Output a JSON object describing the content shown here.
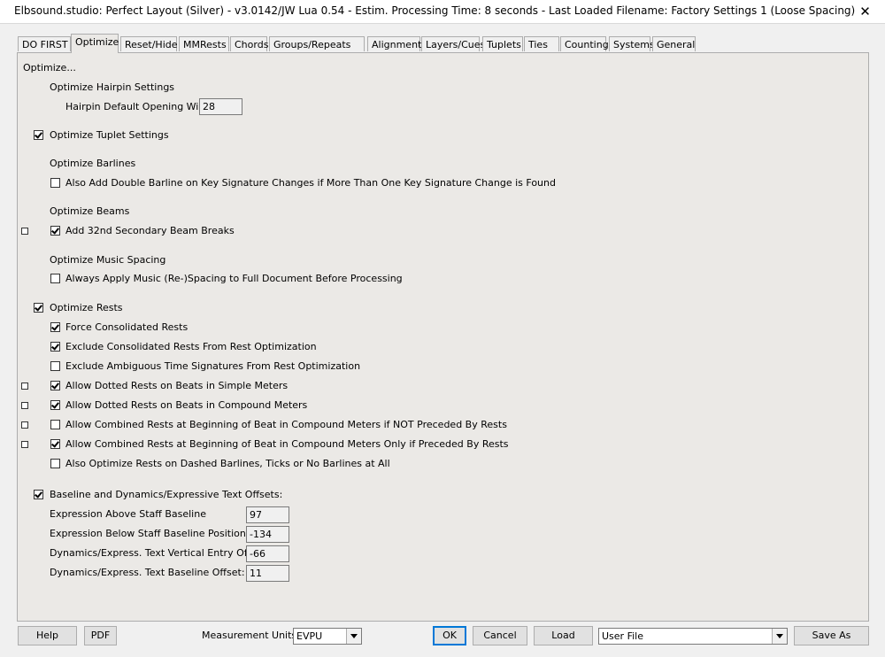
{
  "window": {
    "title": "Elbsound.studio: Perfect Layout (Silver) - v3.0142/JW Lua 0.54 - Estim. Processing Time: 8 seconds - Last Loaded Filename: Factory Settings 1 (Loose Spacing)",
    "close_glyph": "✕"
  },
  "tabs": [
    "DO FIRST",
    "Optimize",
    "Reset/Hide",
    "MMRests",
    "Chords",
    "Groups/Repeats",
    "Alignment",
    "Layers/Cues",
    "Tuplets",
    "Ties",
    "Counting",
    "Systems",
    "General"
  ],
  "optimize": {
    "section_title": "Optimize...",
    "hairpin": {
      "heading": "Optimize Hairpin Settings",
      "width_label": "Hairpin Default Opening Width:",
      "width_value": "28"
    },
    "tuplet": {
      "label": "Optimize Tuplet Settings",
      "checked": true
    },
    "barlines": {
      "heading": "Optimize Barlines",
      "double_label": "Also Add Double Barline on Key Signature Changes if More Than One Key Signature Change is Found",
      "double_checked": false
    },
    "beams": {
      "heading": "Optimize Beams",
      "breaks_label": "Add 32nd Secondary Beam Breaks",
      "breaks_checked": true
    },
    "spacing": {
      "heading": "Optimize Music Spacing",
      "respace_label": "Always Apply Music (Re-)Spacing to Full Document Before Processing",
      "respace_checked": false
    },
    "rests": {
      "label": "Optimize Rests",
      "checked": true,
      "items": [
        {
          "label": "Force Consolidated Rests",
          "checked": true
        },
        {
          "label": "Exclude Consolidated Rests From Rest Optimization",
          "checked": true
        },
        {
          "label": "Exclude Ambiguous Time Signatures From Rest Optimization",
          "checked": false
        },
        {
          "label": "Allow Dotted Rests on Beats in Simple Meters",
          "checked": true
        },
        {
          "label": "Allow Dotted Rests on Beats in Compound Meters",
          "checked": true
        },
        {
          "label": "Allow Combined Rests at Beginning of Beat in Compound Meters if NOT Preceded By Rests",
          "checked": false
        },
        {
          "label": "Allow Combined Rests at Beginning of Beat in Compound Meters Only if Preceded By Rests",
          "checked": true
        },
        {
          "label": "Also Optimize Rests on Dashed Barlines, Ticks or No Barlines at All",
          "checked": false
        }
      ]
    },
    "offsets": {
      "label": "Baseline and Dynamics/Expressive Text Offsets:",
      "checked": true,
      "fields": [
        {
          "label": "Expression Above Staff Baseline",
          "value": "97"
        },
        {
          "label": "Expression Below Staff Baseline Position:",
          "value": "-134"
        },
        {
          "label": "Dynamics/Express. Text Vertical Entry Offset:",
          "value": "-66"
        },
        {
          "label": "Dynamics/Express. Text Baseline Offset:",
          "value": "11"
        }
      ]
    }
  },
  "footer": {
    "help": "Help",
    "pdf": "PDF",
    "units_label": "Measurement Units:",
    "units_value": "EVPU",
    "ok": "OK",
    "cancel": "Cancel",
    "load": "Load",
    "file_value": "User File",
    "save_as": "Save As"
  }
}
